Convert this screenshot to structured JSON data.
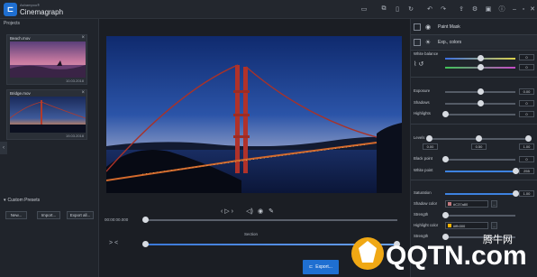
{
  "app": {
    "brand_small": "Ashampoo®",
    "brand_big": "Cinemagraph"
  },
  "titlebar_icons": [
    "folder-icon",
    "copy-icon",
    "page-icon",
    "history-icon",
    "undo-icon",
    "redo-icon",
    "share-icon",
    "settings-icon",
    "layout-icon",
    "info-icon",
    "minimize-icon",
    "maximize-icon",
    "close-icon"
  ],
  "left": {
    "title": "Projects",
    "projects": [
      {
        "name": "Beach.mov",
        "date": "10.03.2018"
      },
      {
        "name": "Bridge.mov",
        "date": "19.03.2018"
      }
    ],
    "collapse_glyph": "‹",
    "custom_presets": {
      "title": "Custom Presets",
      "buttons": [
        "New...",
        "Import...",
        "Export all..."
      ]
    }
  },
  "center": {
    "timecode": "00:00:00.000",
    "section_label": "Section",
    "export_label": "Export...",
    "playback_progress": 0
  },
  "right": {
    "tabs": [
      {
        "label": "Paint Mask"
      },
      {
        "label": "Exp., colors"
      }
    ],
    "white_balance": {
      "label": "White balance",
      "v1": "0",
      "v2": "0"
    },
    "exposure": {
      "label": "Exposure",
      "value": "0.00"
    },
    "shadows": {
      "label": "Shadows",
      "value": "0"
    },
    "highlights": {
      "label": "Highlights",
      "value": "0"
    },
    "levels": {
      "label": "Levels",
      "v1": "0.00",
      "v2": "0.50",
      "v3": "1.00"
    },
    "black_point": {
      "label": "Black point",
      "value": "0"
    },
    "white_point": {
      "label": "White point",
      "value": "255"
    },
    "saturation": {
      "label": "Saturation",
      "value": "1.00"
    },
    "shadow_color": {
      "label": "Shadow color",
      "value": "#C37a80",
      "swatch": "#c37a80"
    },
    "strength1": {
      "label": "Strength"
    },
    "highlight_color": {
      "label": "Highlight color",
      "value": "#ffb300",
      "swatch": "#ffb300"
    },
    "strength2": {
      "label": "Strength"
    }
  },
  "watermark": {
    "text": "QQTN.com",
    "site": "腾牛网"
  }
}
